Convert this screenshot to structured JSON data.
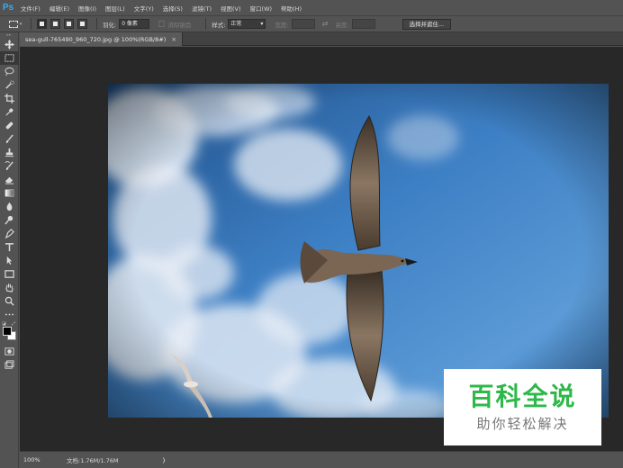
{
  "app": {
    "logo": "Ps",
    "menu": [
      "文件(F)",
      "编辑(E)",
      "图像(I)",
      "图层(L)",
      "文字(Y)",
      "选择(S)",
      "滤镜(T)",
      "视图(V)",
      "窗口(W)",
      "帮助(H)"
    ]
  },
  "options": {
    "tool_icon": "rect-marquee-icon",
    "feather_label": "羽化:",
    "feather_value": "0 像素",
    "antialias_label": "消除锯齿",
    "style_label": "样式:",
    "style_value": "正常",
    "width_label": "宽度:",
    "height_label": "高度:",
    "refine_button": "选择并遮住..."
  },
  "document": {
    "tab_title": "sea-gull-765490_960_720.jpg @ 100%(RGB/8#)",
    "close_glyph": "×"
  },
  "toolbar": {
    "tools": [
      "move-icon",
      "rect-marquee-icon",
      "lasso-icon",
      "quick-select-icon",
      "crop-icon",
      "eyedropper-icon",
      "healing-brush-icon",
      "brush-icon",
      "clone-stamp-icon",
      "history-brush-icon",
      "eraser-icon",
      "gradient-icon",
      "blur-icon",
      "dodge-icon",
      "pen-icon",
      "type-icon",
      "path-select-icon",
      "rectangle-shape-icon",
      "hand-icon",
      "zoom-icon",
      "more-tools-icon"
    ],
    "foreground_color": "#000000",
    "background_color": "#ffffff"
  },
  "status": {
    "zoom": "100%",
    "doc_info": "文档:1.76M/1.76M",
    "arrow": "❭"
  },
  "watermark": {
    "title": "百科全说",
    "subtitle": "助你轻松解决"
  },
  "colors": {
    "ui_panel": "#535353",
    "canvas_bg": "#282828",
    "accent_logo": "#3ba9f5",
    "watermark_green": "#2fb84a"
  }
}
